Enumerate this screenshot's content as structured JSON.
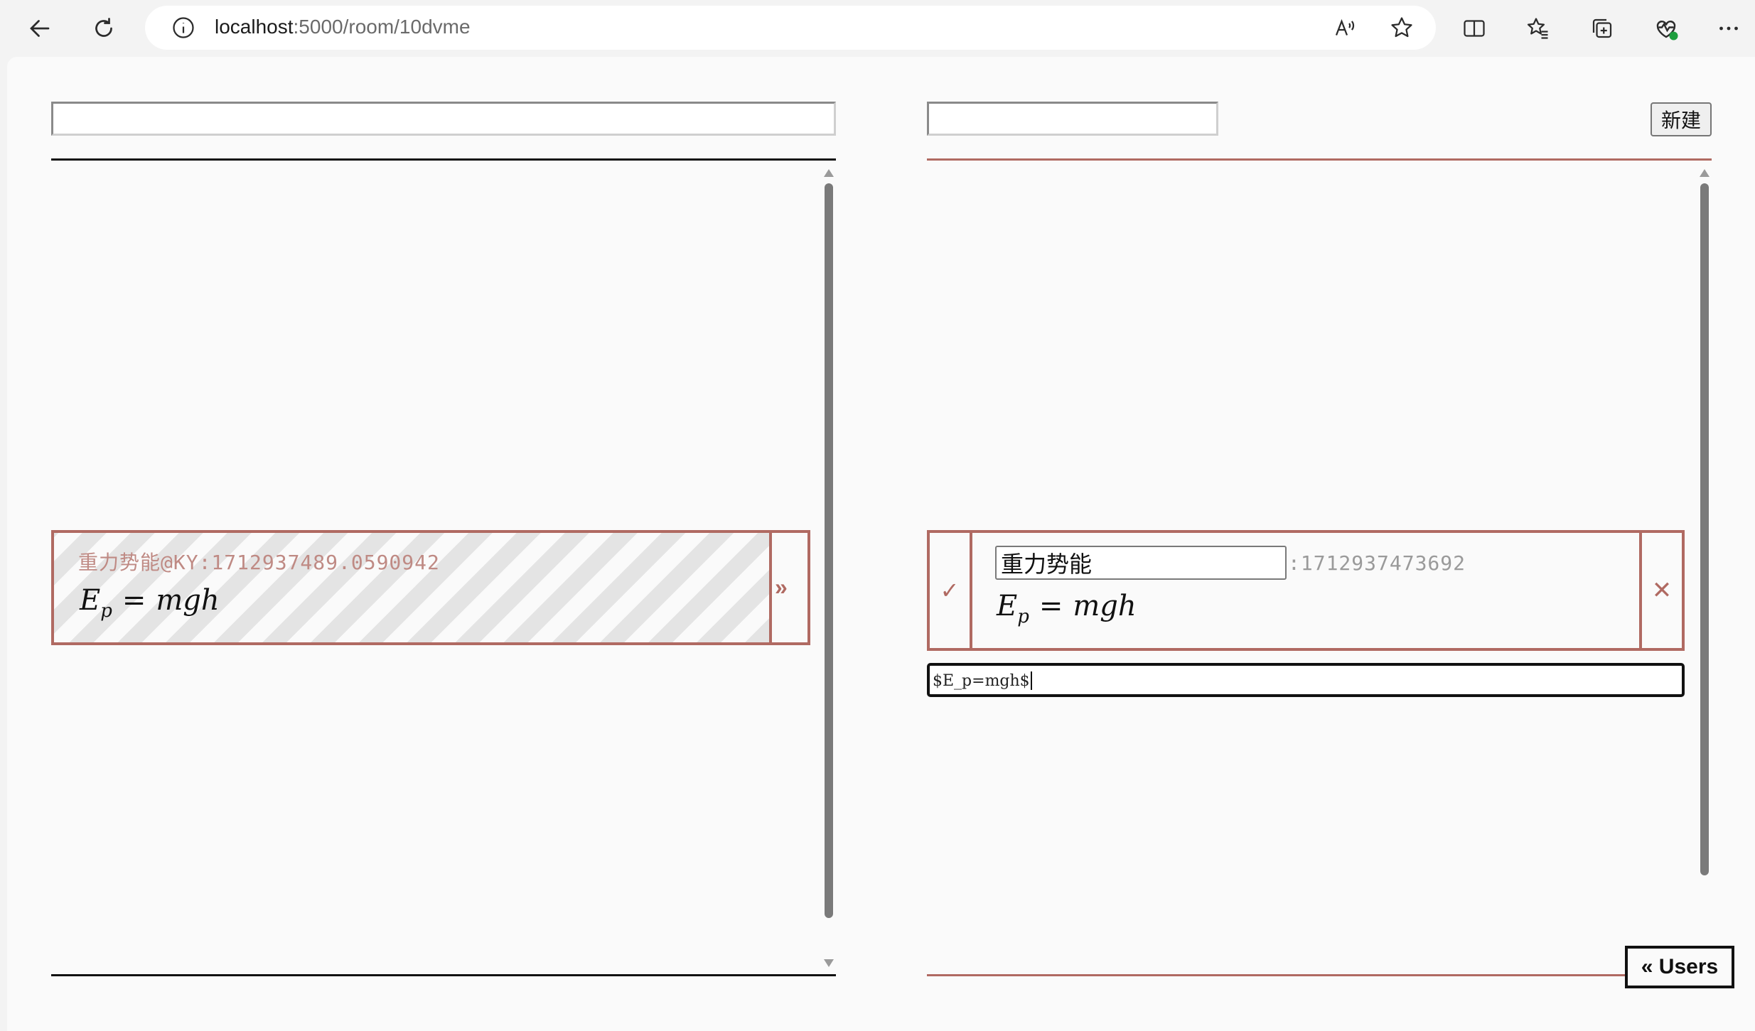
{
  "browser": {
    "url_host": "localhost",
    "url_path": ":5000/room/10dvme",
    "icons": [
      "back-icon",
      "refresh-icon",
      "info-icon",
      "read-aloud-icon",
      "favorite-star-icon",
      "split-screen-icon",
      "favorites-icon",
      "collections-icon",
      "browser-essentials-icon",
      "more-icon"
    ]
  },
  "left_panel": {
    "search_value": "",
    "card": {
      "meta": "重力势能@KY:1712937489.0590942",
      "formula_base": "E",
      "formula_sub": "p",
      "formula_eq": "=",
      "formula_rhs": "mgh",
      "send_label": "»"
    }
  },
  "right_panel": {
    "search_value": "",
    "new_button": "新建",
    "card": {
      "confirm_label": "✓",
      "title_value": "重力势能",
      "id_text": ":1712937473692",
      "formula_base": "E",
      "formula_sub": "p",
      "formula_eq": "=",
      "formula_rhs": "mgh",
      "close_label": "✕"
    },
    "source_value": "$E_p=mgh$"
  },
  "users_button": "« Users",
  "colors": {
    "accent": "#b06a62",
    "meta_text": "#bf8a84",
    "page_bg": "#fafafa"
  }
}
